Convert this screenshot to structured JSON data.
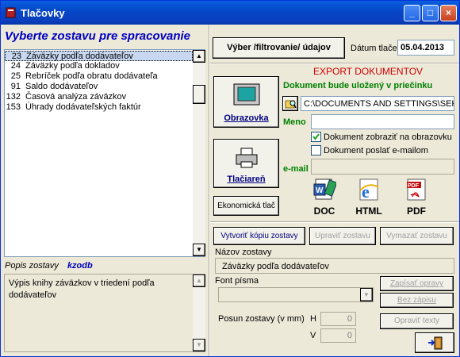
{
  "window": {
    "title": "Tlačovky",
    "minimize": "_",
    "maximize": "□",
    "close": "×"
  },
  "left": {
    "heading": "Vyberte zostavu pre spracovanie",
    "reports": [
      {
        "num": "23",
        "label": "Záväzky podľa dodávateľov"
      },
      {
        "num": "24",
        "label": "Záväzky podľa dokladov"
      },
      {
        "num": "25",
        "label": "Rebríček podľa obratu dodávateľa"
      },
      {
        "num": "91",
        "label": "Saldo dodávateľov"
      },
      {
        "num": "132",
        "label": "Časová analýza záväzkov"
      },
      {
        "num": "153",
        "label": "Úhrady dodávateľských faktúr"
      }
    ],
    "desc_label": "Popis zostavy",
    "desc_code": "kzodb",
    "description": "Výpis knihy záväzkov v triedení podľa dodávateľov"
  },
  "top": {
    "select_filter": "Výber /filtrovanie/ údajov",
    "date_label": "Dátum tlače",
    "date_value": "05.04.2013"
  },
  "output": {
    "screen": "Obrazovka",
    "printer": "Tlačiareň",
    "economic": "Ekonomická tlač"
  },
  "export": {
    "title": "EXPORT DOKUMENTOV",
    "folder_label": "Dokument bude uložený v priečinku",
    "folder_path": "C:\\DOCUMENTS AND SETTINGS\\SEKRE",
    "meno_label": "Meno",
    "meno_value": "",
    "show_on_screen": "Dokument zobraziť na obrazovku",
    "show_on_screen_checked": true,
    "send_email": "Dokument poslať e-mailom",
    "send_email_checked": false,
    "email_label": "e-mail",
    "email_value": "",
    "doc": "DOC",
    "html": "HTML",
    "pdf": "PDF"
  },
  "edit": {
    "copy": "Vytvoriť kópiu zostavy",
    "modify": "Upraviť zostavu",
    "delete": "Vymazať zostavu",
    "name_label": "Názov zostavy",
    "name_value": "Záväzky podľa dodávateľov",
    "font_label": "Font písma",
    "font_value": "",
    "save_changes": "Zapísať opravy",
    "no_save": "Bez zápisu",
    "fix_texts": "Opraviť texty",
    "shift_label": "Posun zostavy (v mm)",
    "h_label": "H",
    "h_value": "0",
    "v_label": "V",
    "v_value": "0"
  }
}
